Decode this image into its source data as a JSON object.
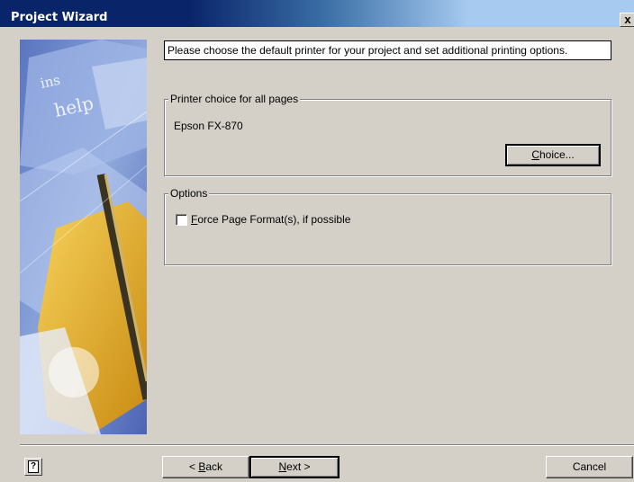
{
  "window": {
    "title": "Project Wizard",
    "close_glyph": "x"
  },
  "side_image": {
    "keycap_1": "ins",
    "keycap_2": "help"
  },
  "instruction": "Please choose the default printer for your project and set additional printing options.",
  "printer_group": {
    "legend": "Printer choice for all pages",
    "printer_name": "Epson FX-870",
    "choice_button": {
      "accel": "C",
      "rest": "hoice..."
    }
  },
  "options_group": {
    "legend": "Options",
    "force_format": {
      "accel": "F",
      "rest": "orce Page Format(s), if possible",
      "checked": false
    }
  },
  "footer": {
    "help_glyph": "?",
    "back_button": {
      "prefix": "< ",
      "accel": "B",
      "rest": "ack"
    },
    "next_button": {
      "accel": "N",
      "rest": "ext >"
    },
    "cancel_label": "Cancel"
  }
}
